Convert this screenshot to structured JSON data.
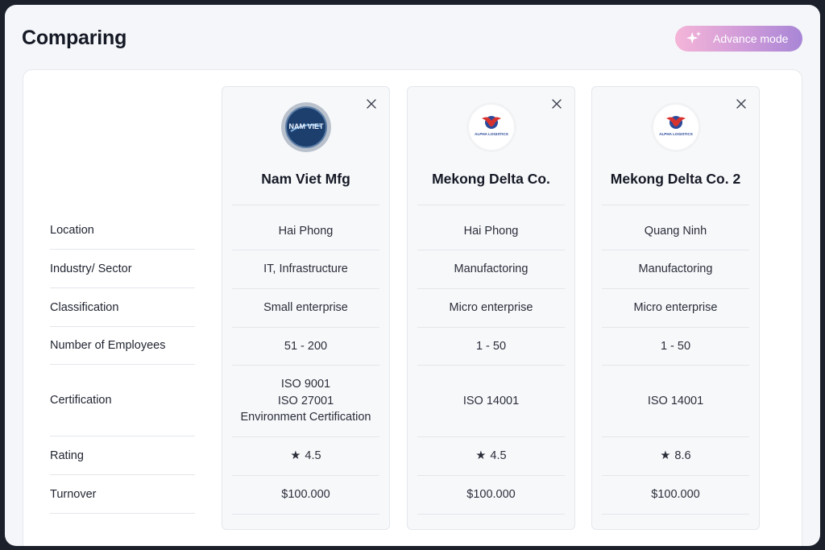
{
  "header": {
    "title": "Comparing",
    "advance_button": "Advance mode"
  },
  "row_labels": [
    "Location",
    "Industry/ Sector",
    "Classification",
    "Number of Employees",
    "Certification",
    "Rating",
    "Turnover"
  ],
  "companies": [
    {
      "name": "Nam Viet Mfg",
      "logo": "nam-viet-logo",
      "location": "Hai Phong",
      "industry": "IT, Infrastructure",
      "classification": "Small enterprise",
      "employees": "51 - 200",
      "certifications": [
        "ISO 9001",
        "ISO 27001",
        "Environment Certification"
      ],
      "rating": "4.5",
      "turnover": "$100.000"
    },
    {
      "name": "Mekong Delta Co.",
      "logo": "alpha-logistics-logo",
      "location": "Hai Phong",
      "industry": "Manufactoring",
      "classification": "Micro enterprise",
      "employees": "1 - 50",
      "certifications": [
        "ISO 14001"
      ],
      "rating": "4.5",
      "turnover": "$100.000"
    },
    {
      "name": "Mekong Delta Co. 2",
      "logo": "alpha-logistics-logo",
      "location": "Quang Ninh",
      "industry": "Manufactoring",
      "classification": "Micro enterprise",
      "employees": "1 - 50",
      "certifications": [
        "ISO 14001"
      ],
      "rating": "8.6",
      "turnover": "$100.000"
    }
  ],
  "icons": {
    "advance": "sparkle-icon",
    "close": "close-icon",
    "rating": "star-icon"
  },
  "logo_text": {
    "nam_viet": "NAM VIET",
    "alpha": "ALPHA LOGISTICS"
  },
  "colors": {
    "accent_gradient": [
      "#f4b5d8",
      "#a886d6"
    ],
    "logo_red": "#d8322f",
    "logo_blue": "#2b4a9a"
  }
}
